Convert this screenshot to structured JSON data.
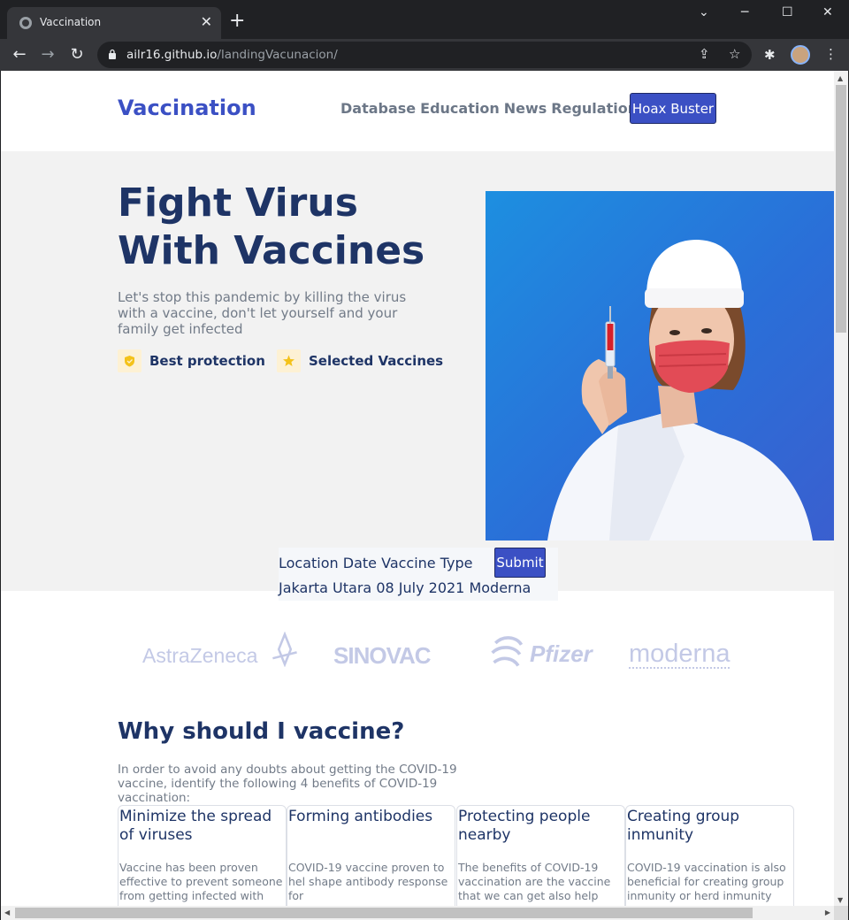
{
  "browser": {
    "tab_title": "Vaccination",
    "url_host": "ailr16.github.io",
    "url_path": "/landingVacunacion/"
  },
  "header": {
    "brand": "Vaccination",
    "nav": [
      "Database",
      "Education",
      "News",
      "Regulation"
    ],
    "cta": "Hoax Buster"
  },
  "hero": {
    "title_line1": "Fight Virus",
    "title_line2": "With Vaccines",
    "subtitle": "Let's stop this pandemic by killing the virus with a vaccine, don't let yourself and your family get infected",
    "features": [
      {
        "label": "Best protection",
        "icon": "shield-icon"
      },
      {
        "label": "Selected Vaccines",
        "icon": "star-icon"
      }
    ]
  },
  "form": {
    "headers": [
      "Location",
      "Date",
      "Vaccine Type"
    ],
    "values": [
      "Jakarta Utara",
      "08 July 2021",
      "Moderna"
    ],
    "submit": "Submit"
  },
  "logos": [
    "AstraZeneca",
    "SINOVAC",
    "Pfizer",
    "moderna"
  ],
  "why": {
    "title": "Why should I vaccine?",
    "intro": "In order to avoid any doubts about getting the COVID-19 vaccine, identify the following 4 benefits of COVID-19 vaccination:",
    "cards": [
      {
        "title": "Minimize the spread of viruses",
        "body": "Vaccine has been proven effective to prevent someone from getting infected with"
      },
      {
        "title": "Forming antibodies",
        "body": "COVID-19 vaccine proven to hel shape antibody response for"
      },
      {
        "title": "Protecting people nearby",
        "body": "The benefits of COVID-19 vaccination are the vaccine that we can get also help"
      },
      {
        "title": "Creating group inmunity",
        "body": "COVID-19 vaccination is also beneficial for creating group inmunity or herd inmunity"
      }
    ]
  },
  "colors": {
    "brand": "#3b50c4",
    "heading": "#1e3466",
    "muted": "#727b88"
  }
}
